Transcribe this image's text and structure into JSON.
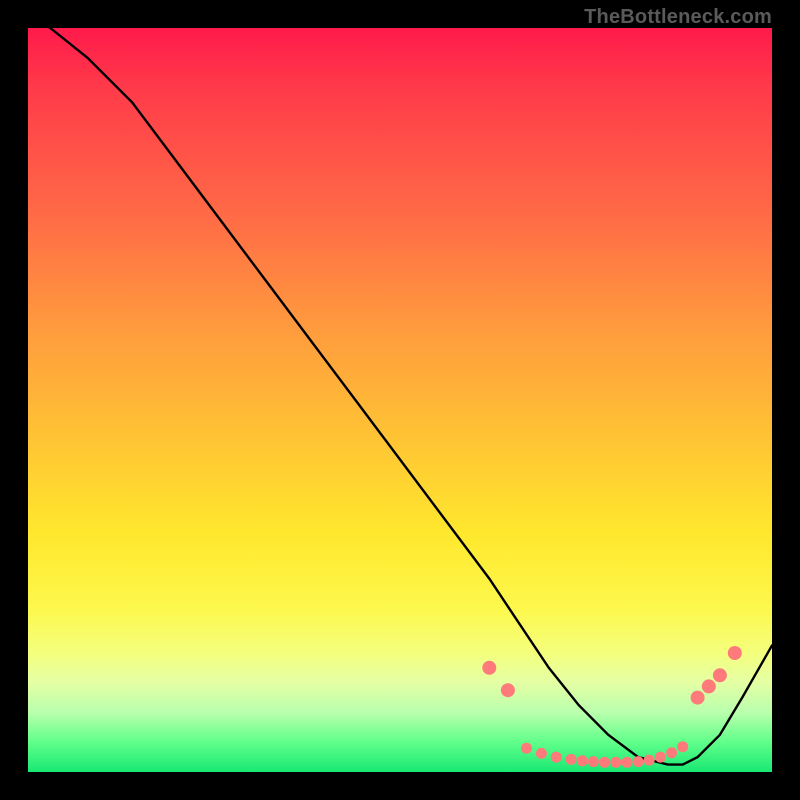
{
  "attribution": "TheBottleneck.com",
  "chart_data": {
    "type": "line",
    "title": "",
    "xlabel": "",
    "ylabel": "",
    "xlim": [
      0,
      100
    ],
    "ylim": [
      0,
      100
    ],
    "series": [
      {
        "name": "curve",
        "x": [
          0,
          3,
          8,
          14,
          20,
          26,
          32,
          38,
          44,
          50,
          56,
          62,
          66,
          70,
          74,
          78,
          82,
          86,
          88,
          90,
          93,
          96,
          100
        ],
        "y": [
          102,
          100,
          96,
          90,
          82,
          74,
          66,
          58,
          50,
          42,
          34,
          26,
          20,
          14,
          9,
          5,
          2,
          1,
          1,
          2,
          5,
          10,
          17
        ]
      },
      {
        "name": "markers-red-left",
        "x": [
          62,
          64.5
        ],
        "y": [
          14,
          11
        ]
      },
      {
        "name": "markers-red-right",
        "x": [
          90,
          91.5,
          93,
          95
        ],
        "y": [
          10,
          11.5,
          13,
          16
        ]
      },
      {
        "name": "markers-bottom-cluster",
        "x": [
          67,
          69,
          71,
          73,
          74.5,
          76,
          77.5,
          79,
          80.5,
          82,
          83.5,
          85,
          86.5,
          88
        ],
        "y": [
          3.2,
          2.5,
          2.0,
          1.7,
          1.5,
          1.4,
          1.3,
          1.3,
          1.3,
          1.4,
          1.6,
          2.0,
          2.6,
          3.4
        ]
      }
    ],
    "marker_color": "#ff7a7a",
    "curve_color": "#000000"
  }
}
